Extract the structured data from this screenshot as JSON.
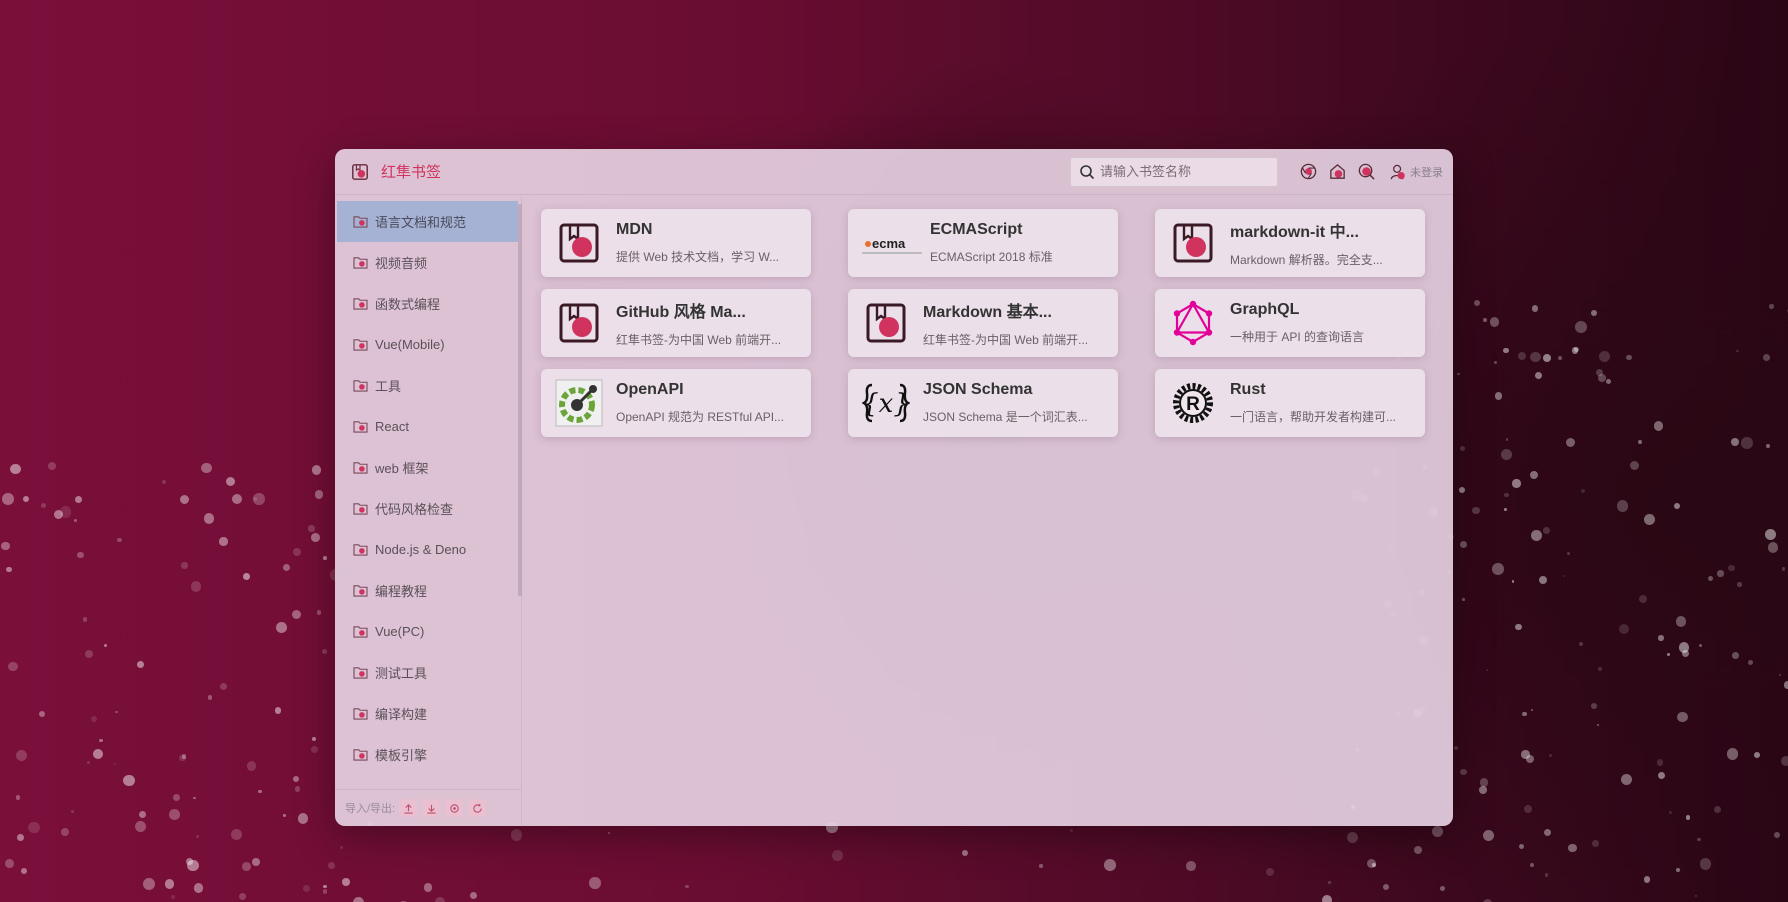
{
  "header": {
    "title": "红隼书签",
    "search_placeholder": "请输入书签名称",
    "icons": [
      "chrome-icon",
      "home-icon",
      "search-engine-icon",
      "user-icon"
    ],
    "user_label": "未登录"
  },
  "sidebar": {
    "items": [
      {
        "label": "语言文档和规范",
        "active": true
      },
      {
        "label": "视频音频"
      },
      {
        "label": "函数式编程"
      },
      {
        "label": "Vue(Mobile)"
      },
      {
        "label": "工具"
      },
      {
        "label": "React"
      },
      {
        "label": "web 框架"
      },
      {
        "label": "代码风格检查"
      },
      {
        "label": "Node.js & Deno"
      },
      {
        "label": "编程教程"
      },
      {
        "label": "Vue(PC)"
      },
      {
        "label": "测试工具"
      },
      {
        "label": "编译构建"
      },
      {
        "label": "模板引擎"
      }
    ],
    "footer_label": "导入/导出:",
    "footer_icons": [
      "upload-icon",
      "download-icon",
      "settings-icon",
      "refresh-icon"
    ]
  },
  "cards": [
    {
      "title": "MDN",
      "desc": "提供 Web 技术文档，学习 W...",
      "icon": "bookmark-icon"
    },
    {
      "title": "ECMAScript",
      "desc": "ECMAScript 2018 标准",
      "icon": "ecma-logo",
      "logo_text": "ecma"
    },
    {
      "title": "markdown-it 中...",
      "desc": "Markdown 解析器。完全支...",
      "icon": "bookmark-icon"
    },
    {
      "title": "GitHub 风格 Ma...",
      "desc": "红隼书签-为中国 Web 前端开...",
      "icon": "bookmark-icon"
    },
    {
      "title": "Markdown 基本...",
      "desc": "红隼书签-为中国 Web 前端开...",
      "icon": "bookmark-icon"
    },
    {
      "title": "GraphQL",
      "desc": "一种用于 API 的查询语言",
      "icon": "graphql-icon"
    },
    {
      "title": "OpenAPI",
      "desc": "OpenAPI 规范为 RESTful API...",
      "icon": "openapi-icon"
    },
    {
      "title": "JSON Schema",
      "desc": "JSON Schema 是一个词汇表...",
      "icon": "json-schema-icon"
    },
    {
      "title": "Rust",
      "desc": "一门语言，帮助开发者构建可...",
      "icon": "rust-icon"
    }
  ],
  "colors": {
    "accent": "#d0335e",
    "active_item": "#a6b2d4"
  }
}
